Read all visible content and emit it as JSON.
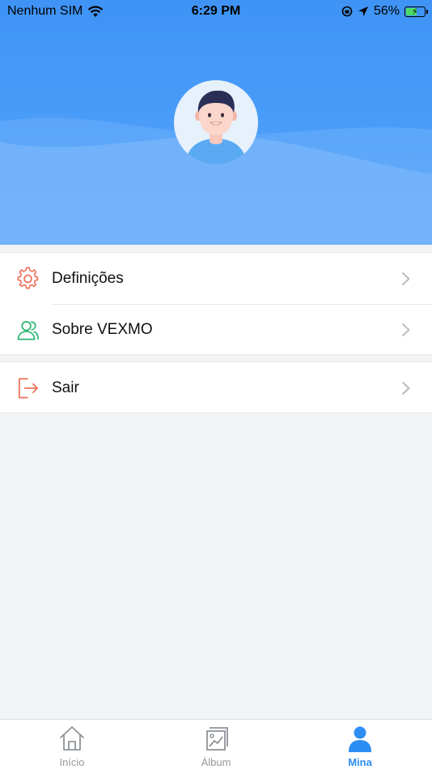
{
  "status_bar": {
    "carrier": "Nenhum SIM",
    "time": "6:29 PM",
    "battery_percent": "56%",
    "battery_level": 0.56
  },
  "header": {
    "background_color": "#4b9df8",
    "avatar_icon": "user-avatar"
  },
  "menu": {
    "group1": [
      {
        "label": "Definições",
        "icon": "gear-icon",
        "icon_color": "#f0705a"
      },
      {
        "label": "Sobre VEXMO",
        "icon": "users-icon",
        "icon_color": "#2bb673"
      }
    ],
    "group2": [
      {
        "label": "Sair",
        "icon": "logout-icon",
        "icon_color": "#f0705a"
      }
    ]
  },
  "tabbar": {
    "accent_color": "#2c8ef3",
    "tabs": [
      {
        "label": "Início",
        "icon": "home-icon",
        "active": false
      },
      {
        "label": "Álbum",
        "icon": "album-icon",
        "active": false
      },
      {
        "label": "Mina",
        "icon": "person-icon",
        "active": true
      }
    ]
  }
}
